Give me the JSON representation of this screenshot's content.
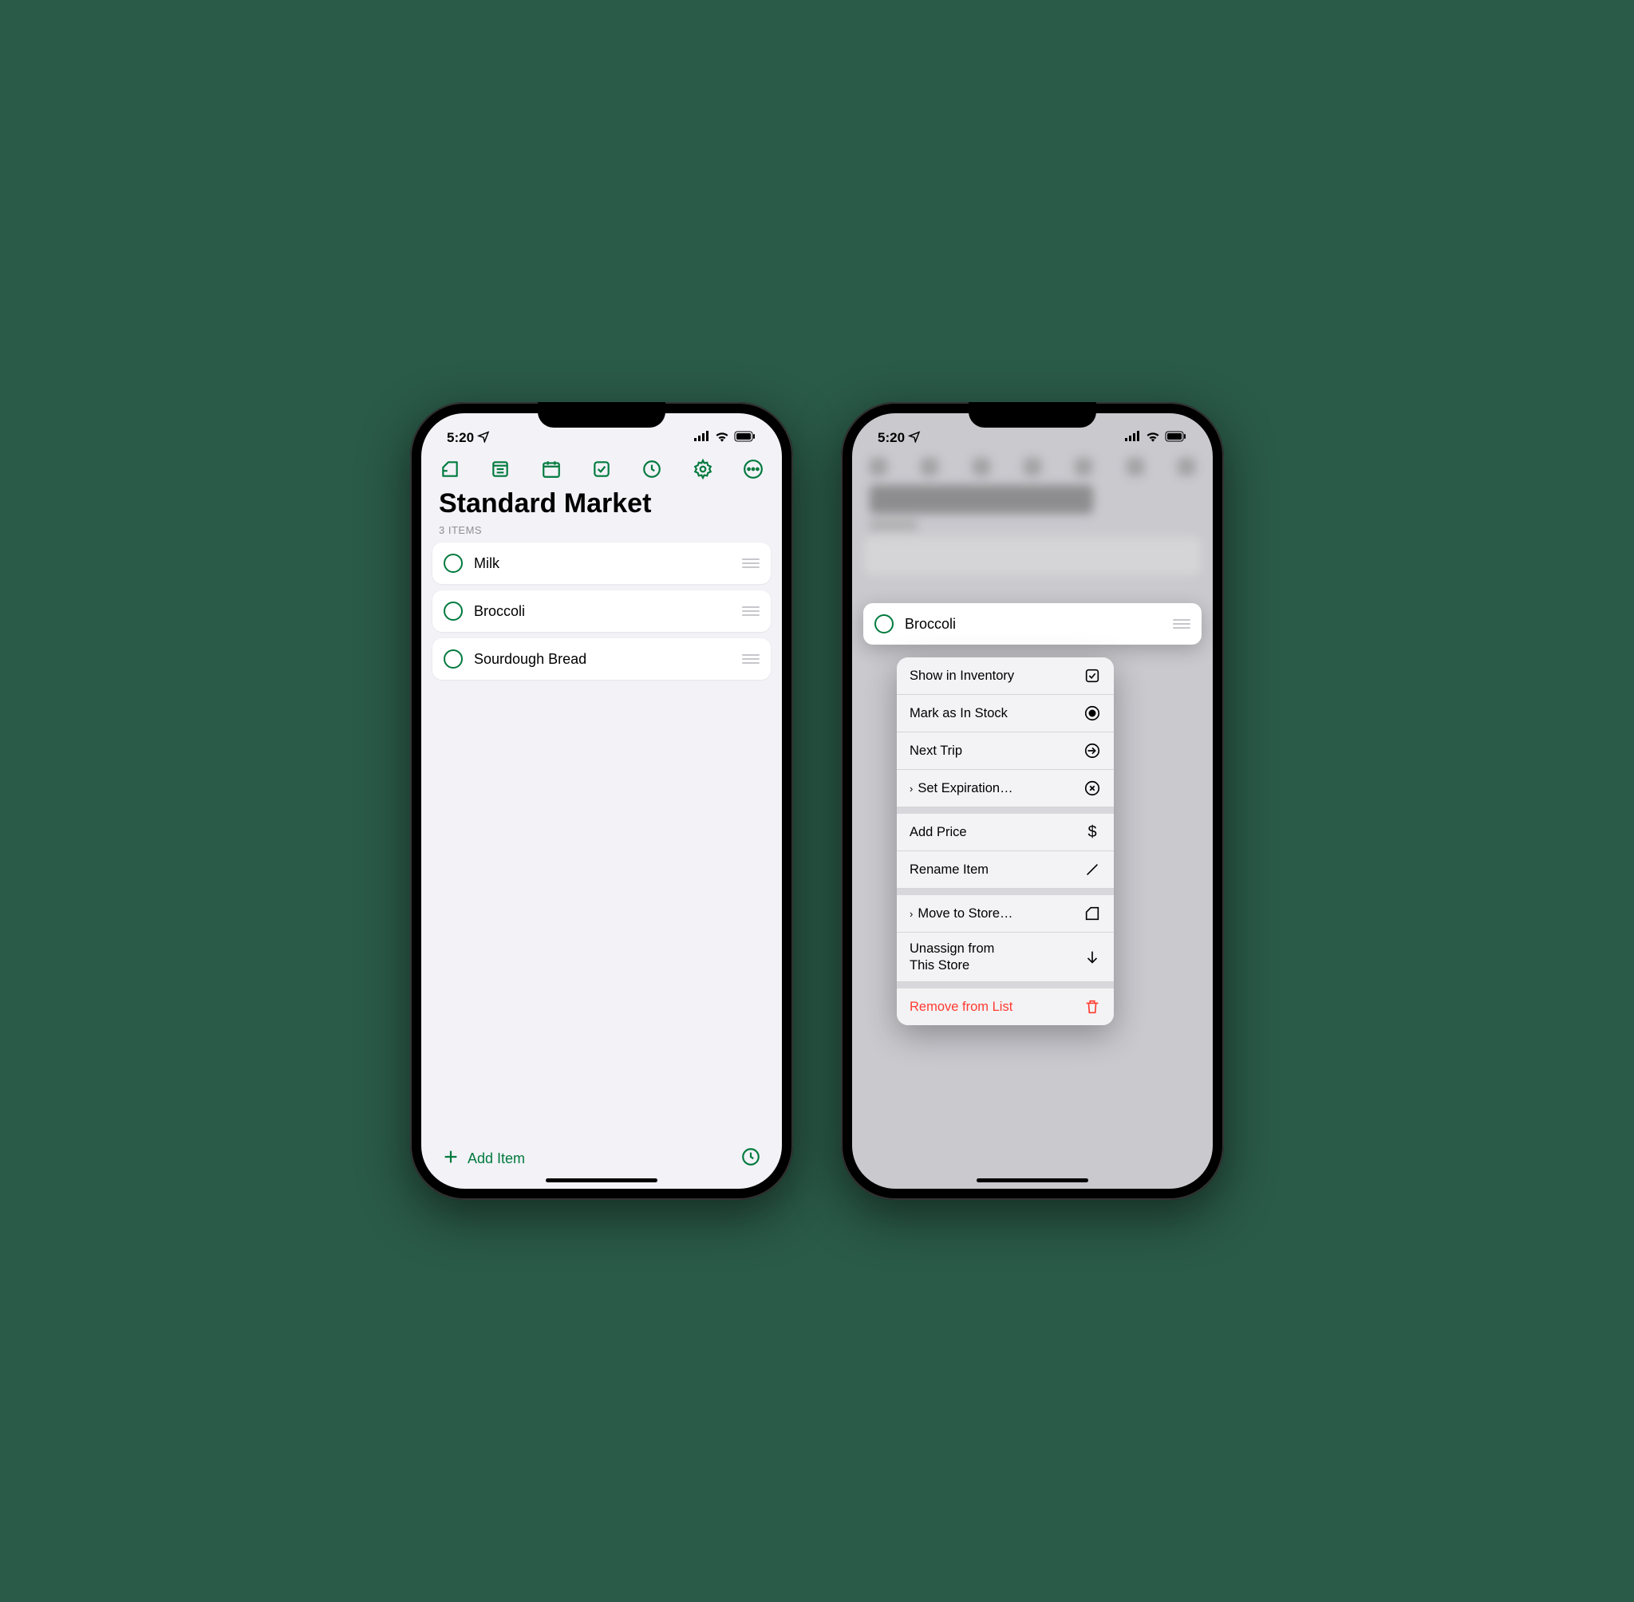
{
  "status": {
    "time": "5:20"
  },
  "page": {
    "title": "Standard Market",
    "subheader": "3 ITEMS"
  },
  "items": [
    {
      "label": "Milk"
    },
    {
      "label": "Broccoli"
    },
    {
      "label": "Sourdough Bread"
    }
  ],
  "bottom": {
    "add": "Add Item"
  },
  "context": {
    "selected_item": "Broccoli",
    "menu": {
      "show_inventory": "Show in Inventory",
      "mark_in_stock": "Mark as In Stock",
      "next_trip": "Next Trip",
      "set_expiration": "Set Expiration…",
      "add_price": "Add Price",
      "rename": "Rename Item",
      "move_store": "Move to Store…",
      "unassign": "Unassign from\nThis Store",
      "remove": "Remove from List"
    }
  },
  "colors": {
    "accent": "#007a3d",
    "destructive": "#ff3b30"
  }
}
